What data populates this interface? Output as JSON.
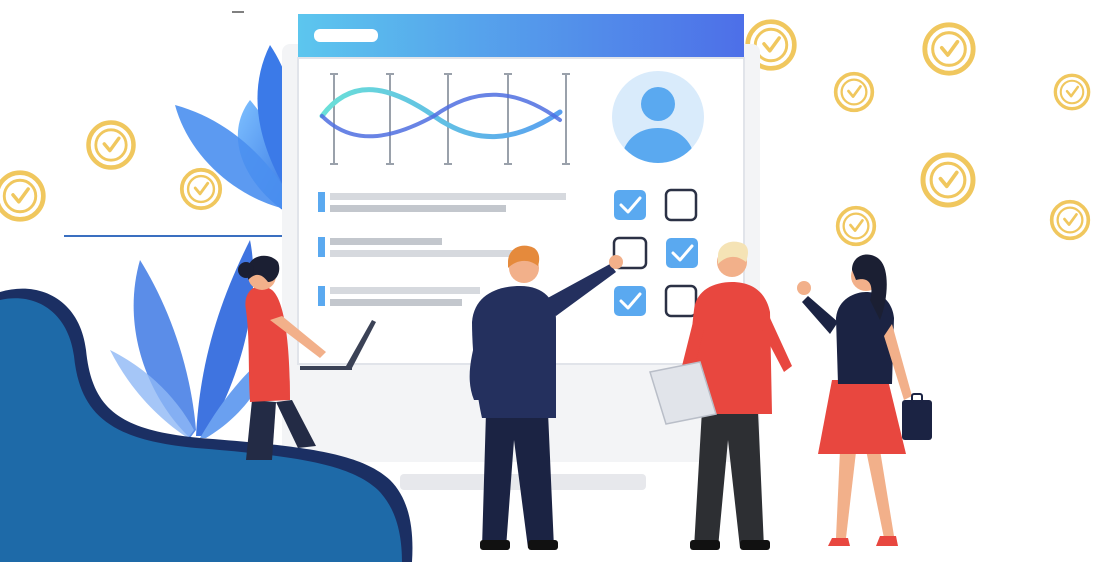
{
  "scene": "team-survey-illustration",
  "colors": {
    "accent_blue": "#5aa9f0",
    "navy_blue": "#1b2f63",
    "wave_blue": "#1e6aa8",
    "coral_red": "#e8473f",
    "gold": "#f0c75e",
    "skin": "#f2b08a",
    "screen_header": "#54b6ec"
  },
  "icons": [
    "check-circle-icon",
    "user-avatar-icon",
    "checkbox-icon",
    "laptop-icon",
    "leaf-icon",
    "briefcase-icon"
  ],
  "screen": {
    "checkboxes": [
      {
        "row": 1,
        "left_checked": true,
        "right_checked": false
      },
      {
        "row": 2,
        "left_checked": false,
        "right_checked": true
      },
      {
        "row": 3,
        "left_checked": true,
        "right_checked": false
      }
    ],
    "bars": [
      {
        "row": 1,
        "fill": 0.72
      },
      {
        "row": 2,
        "fill": 0.45
      },
      {
        "row": 3,
        "fill": 0.6
      }
    ]
  }
}
